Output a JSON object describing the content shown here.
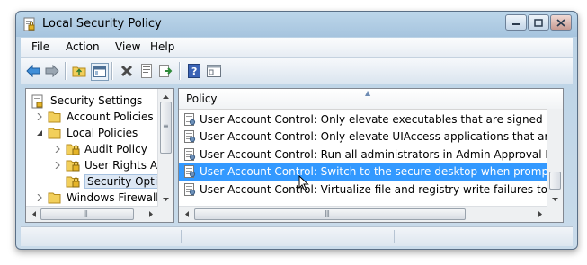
{
  "window": {
    "title": "Local Security Policy",
    "app_icon": "security-policy-icon"
  },
  "menu": [
    "File",
    "Action",
    "View",
    "Help"
  ],
  "toolbar": [
    "back-arrow-icon",
    "forward-arrow-icon",
    "up-folder-icon",
    "show-hide-tree-icon",
    "delete-icon",
    "properties-icon",
    "export-list-icon",
    "help-icon",
    "console-icon"
  ],
  "tree": {
    "items": [
      {
        "label": "Security Settings",
        "level": 0,
        "expander": "none"
      },
      {
        "label": "Account Policies",
        "level": 1,
        "expander": "collapsed"
      },
      {
        "label": "Local Policies",
        "level": 1,
        "expander": "expanded"
      },
      {
        "label": "Audit Policy",
        "level": 2,
        "expander": "collapsed"
      },
      {
        "label": "User Rights Assig",
        "level": 2,
        "expander": "collapsed"
      },
      {
        "label": "Security Options",
        "level": 2,
        "expander": "none",
        "selected": true
      },
      {
        "label": "Windows Firewall w",
        "level": 1,
        "expander": "collapsed"
      }
    ]
  },
  "list": {
    "column_header": "Policy",
    "rows": [
      {
        "text": "User Account Control: Only elevate executables that are signed and valid."
      },
      {
        "text": "User Account Control: Only elevate UIAccess applications that are install..."
      },
      {
        "text": "User Account Control: Run all administrators in Admin Approval Mode"
      },
      {
        "text": "User Account Control: Switch to the secure desktop when prompting for",
        "selected": true
      },
      {
        "text": "User Account Control: Virtualize file and registry write failures to per-user..."
      }
    ]
  },
  "colors": {
    "selection": "#3399ff",
    "window_frame": "#bcd6ea"
  }
}
